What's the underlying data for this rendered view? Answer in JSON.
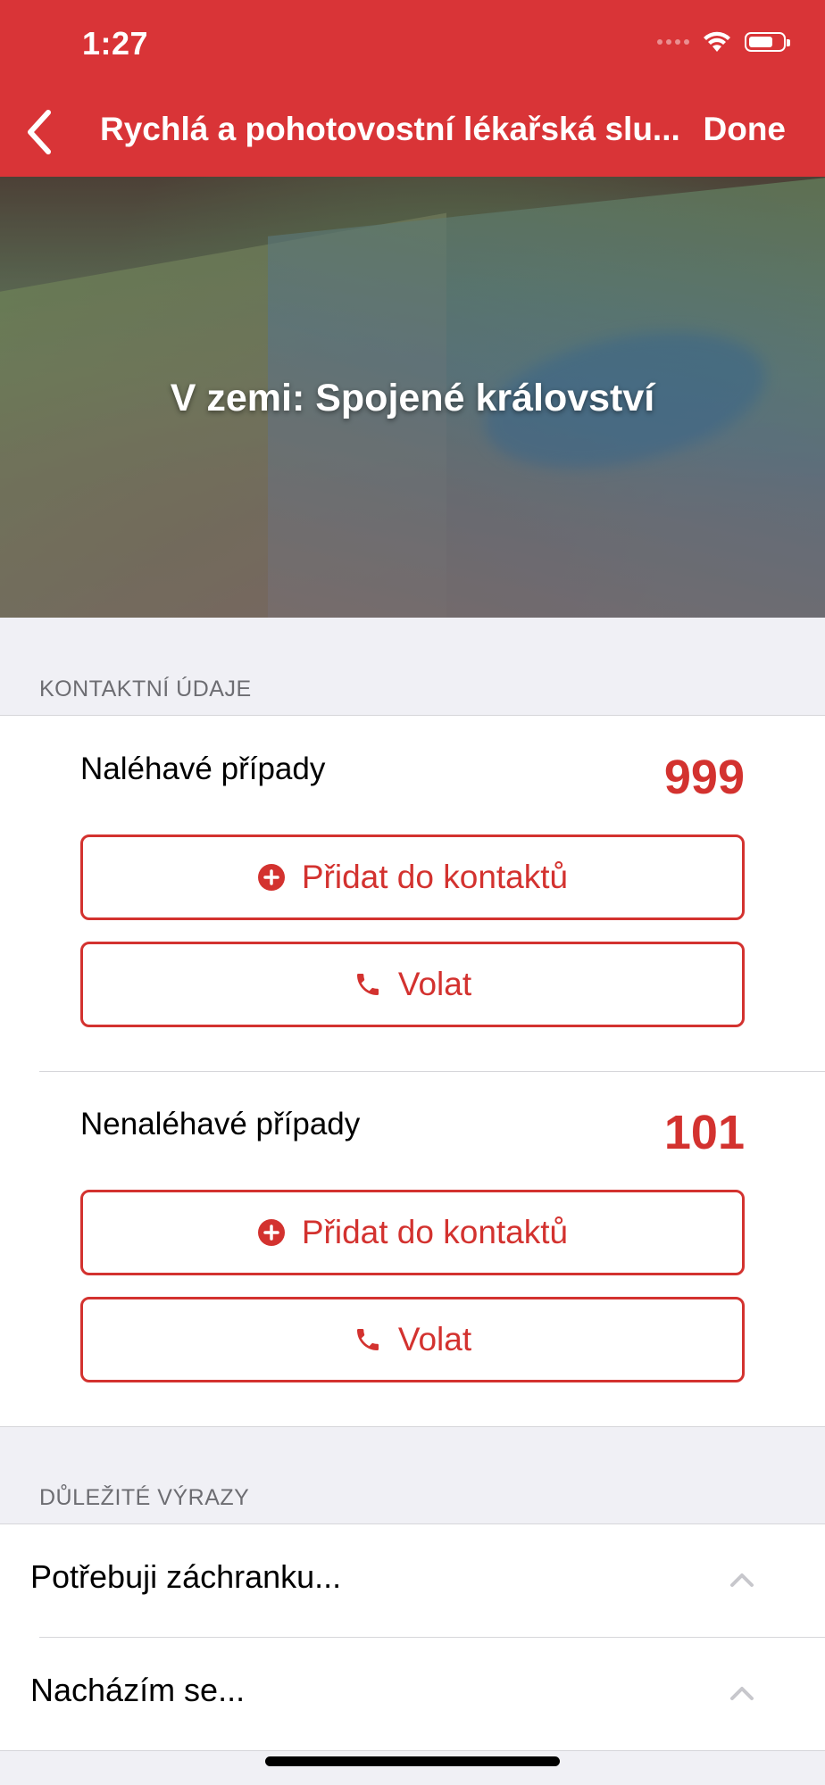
{
  "status_bar": {
    "time": "1:27"
  },
  "nav": {
    "title": "Rychlá a pohotovostní lékařská slu...",
    "done_label": "Done"
  },
  "hero": {
    "title": "V zemi: Spojené království"
  },
  "contacts": {
    "section_title": "KONTAKTNÍ ÚDAJE",
    "items": [
      {
        "label": "Naléhavé případy",
        "number": "999",
        "add_label": "Přidat do kontaktů",
        "call_label": "Volat"
      },
      {
        "label": "Nenaléhavé případy",
        "number": "101",
        "add_label": "Přidat do kontaktů",
        "call_label": "Volat"
      }
    ]
  },
  "phrases": {
    "section_title": "DŮLEŽITÉ VÝRAZY",
    "items": [
      {
        "label": "Potřebuji záchranku..."
      },
      {
        "label": "Nacházím se..."
      }
    ]
  },
  "colors": {
    "header": "#d93437",
    "accent": "#d3322f",
    "background": "#f0f0f5"
  }
}
